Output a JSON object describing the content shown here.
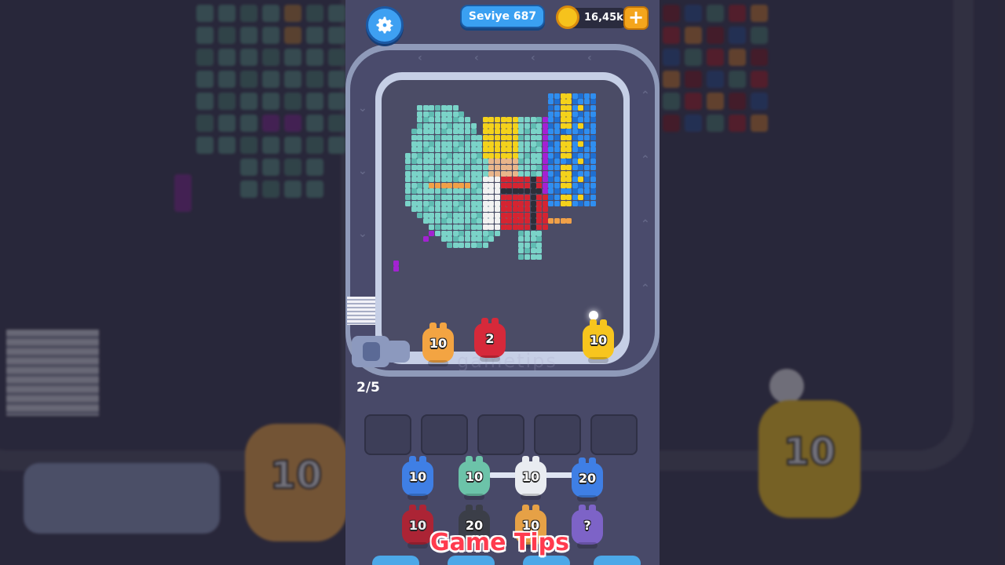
{
  "header": {
    "level_label": "Seviye 687",
    "coins": "16,45k",
    "add_coins_symbol": "+"
  },
  "board": {
    "watermark": "gametips",
    "conveyor_count": "2/5"
  },
  "conveyor_pigs": [
    {
      "color": "orange",
      "count": "10"
    },
    {
      "color": "red",
      "count": "2"
    },
    {
      "color": "yellow",
      "count": "10"
    }
  ],
  "queue_row1": [
    {
      "color": "blue",
      "count": "10"
    },
    {
      "color": "teal",
      "count": "10"
    },
    {
      "color": "white",
      "count": "10"
    },
    {
      "color": "blue",
      "count": "20"
    }
  ],
  "queue_row2": [
    {
      "color": "darkred",
      "count": "10"
    },
    {
      "color": "black",
      "count": "20"
    },
    {
      "color": "orange2",
      "count": "10"
    },
    {
      "color": "purple",
      "count": "?"
    }
  ],
  "caption": "Game Tips",
  "background_chip": "10",
  "colors": {
    "accent_blue": "#3ea0f2",
    "coin_gold": "#f6c21c",
    "caption_red": "#ff3b4e"
  }
}
